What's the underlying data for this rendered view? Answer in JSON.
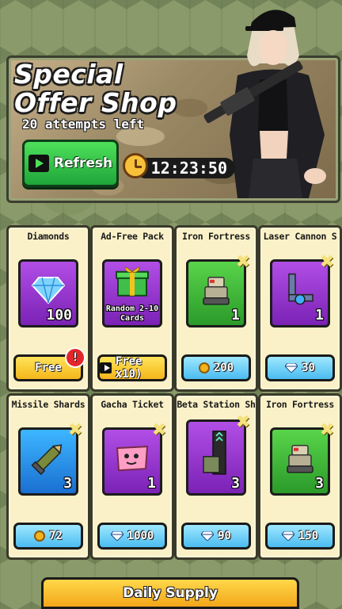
{
  "header": {
    "title": "Special Offer Shop",
    "attempts_text": "20 attempts left",
    "refresh_label": "Refresh",
    "timer": "12:23:50"
  },
  "items": [
    {
      "name": "Diamonds",
      "count": "100",
      "tile_color": "purple",
      "price": "Free",
      "price_type": "free",
      "icon": "diamond-icon",
      "notification": "!"
    },
    {
      "name": "Ad-Free Pack",
      "count": "",
      "label": "Random 2-10 Cards",
      "tile_color": "purple",
      "price": "Free x10)",
      "price_type": "ad",
      "icon": "gift-box-icon"
    },
    {
      "name": "Iron Fortress",
      "count": "1",
      "tile_color": "green",
      "price": "200",
      "price_type": "coin",
      "icon": "robot-icon"
    },
    {
      "name": "Laser Cannon S",
      "count": "1",
      "tile_color": "purple",
      "price": "30",
      "price_type": "gem",
      "icon": "laser-cannon-icon"
    },
    {
      "name": "Missile Shards",
      "count": "3",
      "tile_color": "blue",
      "price": "72",
      "price_type": "coin",
      "icon": "missile-icon"
    },
    {
      "name": "Gacha Ticket",
      "count": "1",
      "tile_color": "purple",
      "price": "1000",
      "price_type": "gem",
      "icon": "ticket-icon"
    },
    {
      "name": "Beta Station Sh",
      "count": "3",
      "tile_color": "purple",
      "price": "90",
      "price_type": "gem",
      "icon": "station-icon"
    },
    {
      "name": "Iron Fortress",
      "count": "3",
      "tile_color": "green",
      "price": "150",
      "price_type": "gem",
      "icon": "robot-icon"
    }
  ],
  "footer": {
    "daily_supply_label": "Daily Supply"
  }
}
